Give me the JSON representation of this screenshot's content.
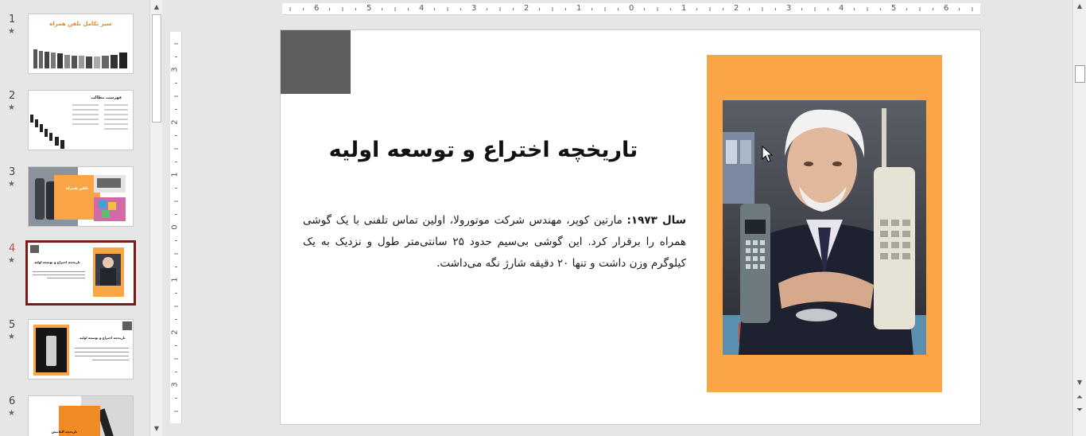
{
  "thumbnails": [
    {
      "number": "1",
      "title": "سیر تکامل تلفن همراه"
    },
    {
      "number": "2",
      "title": "فهرست مطالب"
    },
    {
      "number": "3",
      "title": "تلفن همراه"
    },
    {
      "number": "4",
      "title": "تاریخچه اختراع و توسعه اولیه"
    },
    {
      "number": "5",
      "title": "تاریخچه اختراع و توسعه اولیه"
    },
    {
      "number": "6",
      "title": "تاریخچه آلمانیش"
    }
  ],
  "star": "★",
  "selected_slide": "4",
  "ruler": {
    "horizontal": [
      "6",
      "5",
      "4",
      "3",
      "2",
      "1",
      "0",
      "1",
      "2",
      "3",
      "4",
      "5",
      "6"
    ],
    "vertical": [
      "3",
      "2",
      "1",
      "0",
      "1",
      "2",
      "3"
    ]
  },
  "slide": {
    "title": "تاریخچه اختراع و توسعه اولیه",
    "body_bold": "سال ۱۹۷۳:",
    "body_text": " مارتین کوپر، مهندس شرکت موتورولا، اولین تماس تلفنی با یک گوشی همراه را برقرار کرد. این گوشی بی‌سیم حدود ۲۵ سانتی‌متر طول و نزدیک به یک کیلوگرم وزن داشت و تنها ۲۰ دقیقه شارژ نگه می‌داشت."
  },
  "colors": {
    "orange": "#fba646",
    "gray_block": "#5e5e5e",
    "selection_border": "#7a1b1b"
  }
}
